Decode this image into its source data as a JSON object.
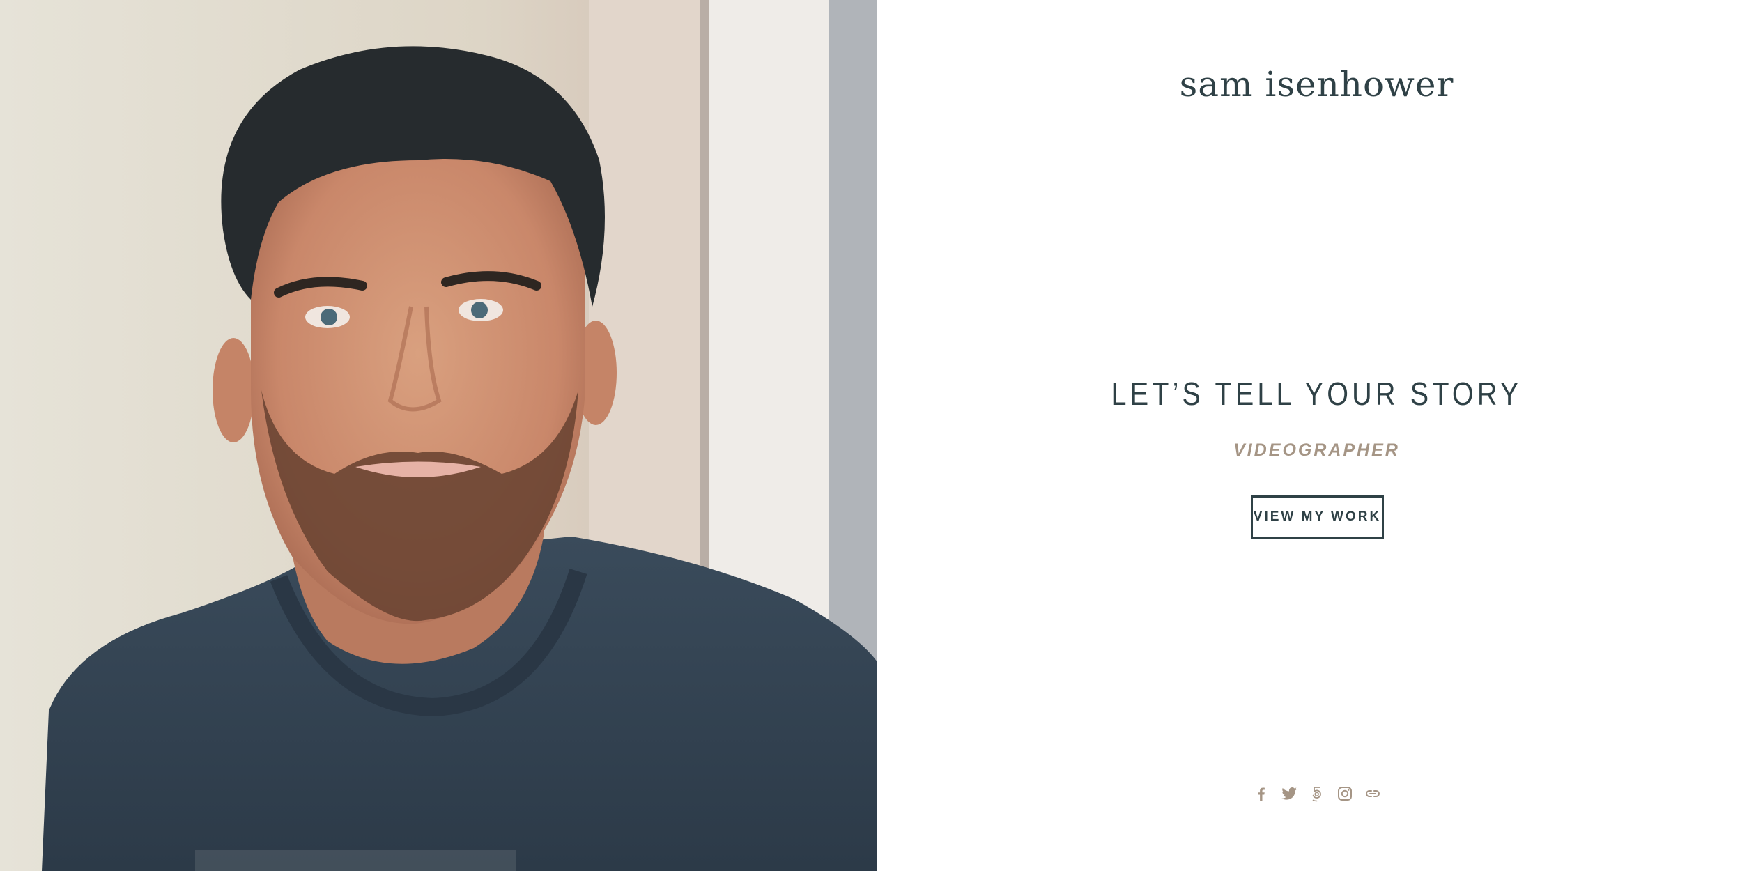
{
  "header": {
    "site_title": "sam isenhower"
  },
  "hero": {
    "heading": "LET’S TELL YOUR STORY",
    "subheading": "VIDEOGRAPHER",
    "cta_label": "VIEW MY WORK"
  },
  "social": {
    "icons": [
      "facebook-icon",
      "twitter-icon",
      "500px-icon",
      "instagram-icon",
      "link-icon"
    ]
  },
  "colors": {
    "primary": "#2f4146",
    "accent": "#a59585",
    "background": "#ffffff"
  }
}
